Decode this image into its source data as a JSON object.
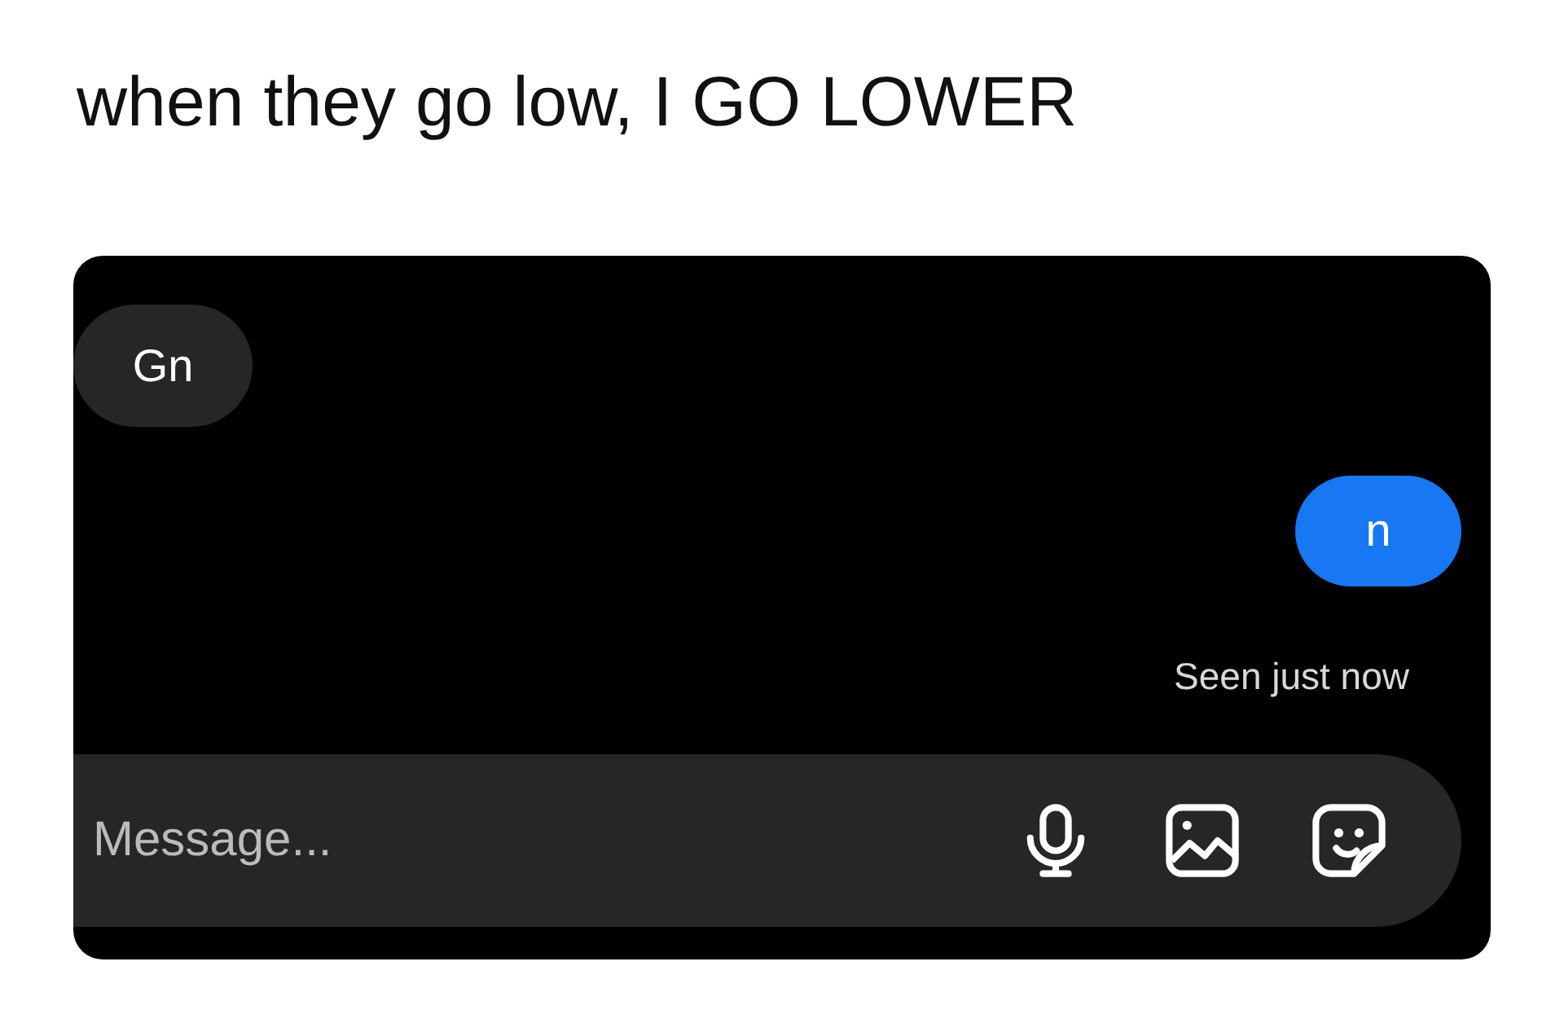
{
  "caption": "when they go low, I GO LOWER",
  "messages": [
    {
      "text": "Gn",
      "kind": "incoming"
    },
    {
      "text": "n",
      "kind": "outgoing"
    }
  ],
  "receipt": "Seen just now",
  "composer": {
    "placeholder": "Message..."
  }
}
